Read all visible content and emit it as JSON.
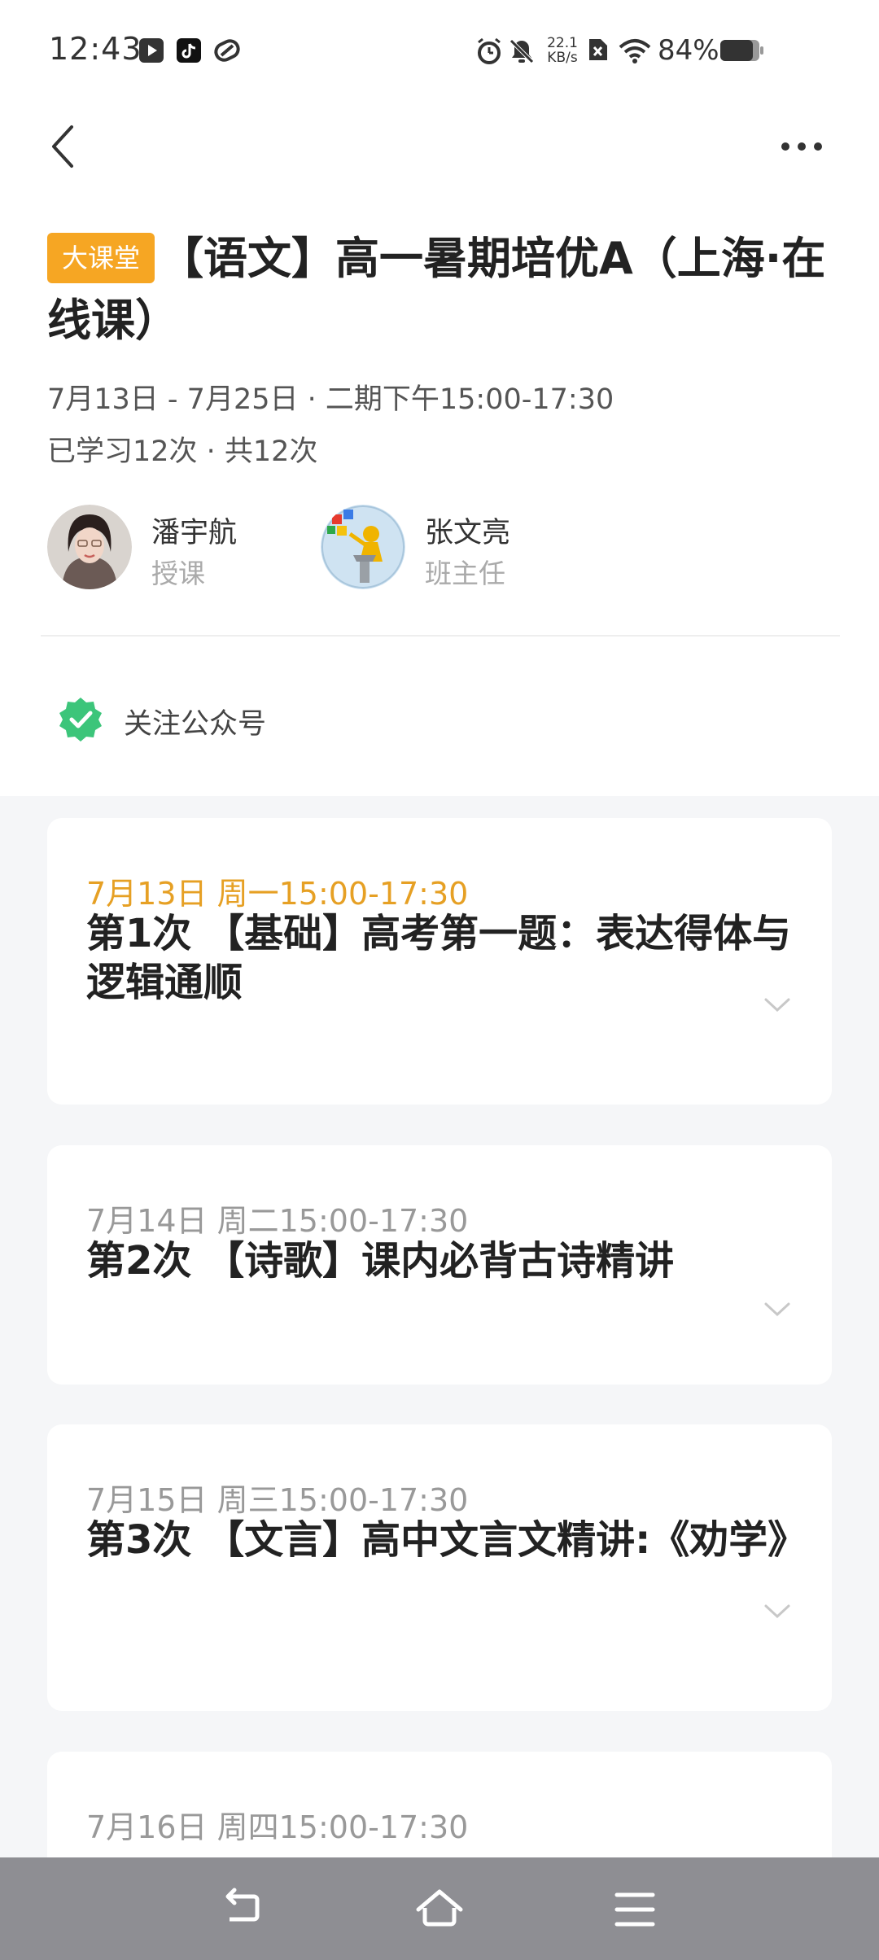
{
  "status_bar": {
    "time": "12:43",
    "net_speed_value": "22.1",
    "net_speed_unit": "KB/s",
    "battery": "84%"
  },
  "header": {
    "tag": "大课堂",
    "title": "【语文】高一暑期培优A（上海·在线课）",
    "date_range": "7月13日 - 7月25日 · 二期下午15:00-17:30",
    "progress": "已学习12次 · 共12次"
  },
  "teachers": [
    {
      "name": "潘宇航",
      "role": "授课"
    },
    {
      "name": "张文亮",
      "role": "班主任"
    }
  ],
  "follow": {
    "label": "关注公众号"
  },
  "lessons": [
    {
      "date": "7月13日 周一15:00-17:30",
      "title": "第1次 【基础】高考第一题：表达得体与逻辑通顺",
      "active": true
    },
    {
      "date": "7月14日 周二15:00-17:30",
      "title": "第2次 【诗歌】课内必背古诗精讲",
      "active": false
    },
    {
      "date": "7月15日 周三15:00-17:30",
      "title": "第3次 【文言】高中文言文精讲:《劝学》",
      "active": false
    },
    {
      "date": "7月16日 周四15:00-17:30",
      "title": "",
      "active": false
    }
  ],
  "icons": {
    "back": "chevron-left-icon",
    "more": "more-dots-icon",
    "follow": "verified-badge-icon",
    "expand": "chevron-down-icon",
    "nav_back": "nav-back-icon",
    "nav_home": "nav-home-icon",
    "nav_menu": "nav-menu-icon"
  },
  "colors": {
    "tag_bg": "#f6a623",
    "active_date": "#e6a024",
    "follow_badge": "#3cc57a",
    "page_bg": "#f5f6f8",
    "nav_bar": "#8e8e93"
  }
}
